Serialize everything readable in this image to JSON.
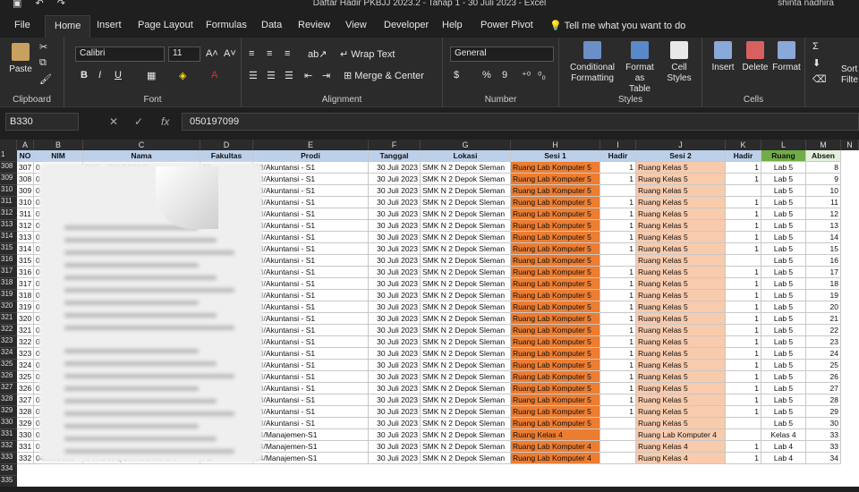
{
  "window": {
    "title": "Daftar Hadir PKBJJ 2023.2 - Tahap 1 - 30 Juli 2023 - Excel",
    "user": "shinta nadhira"
  },
  "menu": [
    "File",
    "Home",
    "Insert",
    "Page Layout",
    "Formulas",
    "Data",
    "Review",
    "View",
    "Developer",
    "Help",
    "Power Pivot"
  ],
  "tellme": "Tell me what you want to do",
  "ribbon": {
    "clipboard": {
      "paste": "Paste",
      "label": "Clipboard"
    },
    "font": {
      "name": "Calibri",
      "size": "11",
      "label": "Font",
      "bold": "B",
      "italic": "I",
      "underline": "U"
    },
    "alignment": {
      "wrap": "Wrap Text",
      "merge": "Merge & Center",
      "label": "Alignment"
    },
    "number": {
      "format": "General",
      "label": "Number",
      "percent": "%",
      "comma": "9"
    },
    "styles": {
      "cond": "Conditional",
      "cond2": "Formatting",
      "fmt": "Format as",
      "fmt2": "Table",
      "cell": "Cell",
      "cell2": "Styles",
      "label": "Styles"
    },
    "cells": {
      "insert": "Insert",
      "delete": "Delete",
      "format": "Format",
      "label": "Cells"
    },
    "editing": {
      "sort": "Sort",
      "filter": "Filte"
    }
  },
  "formula_bar": {
    "name_box": "B330",
    "value": "050197099",
    "fx": "fx"
  },
  "columns": [
    "A",
    "B",
    "C",
    "D",
    "E",
    "F",
    "G",
    "H",
    "I",
    "J",
    "K",
    "L",
    "M",
    "N"
  ],
  "headers": [
    "NO",
    "NIM",
    "Nama",
    "Fakultas",
    "Prodi",
    "Tanggal",
    "Lokasi",
    "Sesi 1",
    "Hadir",
    "Sesi 2",
    "Hadir",
    "Ruang",
    "Absen"
  ],
  "rows": [
    {
      "r": "308",
      "no": "307",
      "nim": "0",
      "nama": "DWI ...RI LESTARI",
      "fak": "FE",
      "prodi": "83/Akuntansi - S1",
      "tgl": "30 Juli 2023",
      "lok": "SMK N 2 Depok Sleman",
      "s1": "Ruang Lab Komputer 5",
      "h1": "1",
      "s2": "Ruang Kelas 5",
      "h2": "1",
      "ruang": "Lab 5",
      "absen": "8"
    },
    {
      "r": "309",
      "no": "308",
      "nim": "0",
      "nama": "",
      "fak": "FE",
      "prodi": "83/Akuntansi - S1",
      "tgl": "30 Juli 2023",
      "lok": "SMK N 2 Depok Sleman",
      "s1": "Ruang Lab Komputer 5",
      "h1": "1",
      "s2": "Ruang Kelas 5",
      "h2": "1",
      "ruang": "Lab 5",
      "absen": "9"
    },
    {
      "r": "310",
      "no": "309",
      "nim": "0",
      "nama": "",
      "fak": "FE",
      "prodi": "83/Akuntansi - S1",
      "tgl": "30 Juli 2023",
      "lok": "SMK N 2 Depok Sleman",
      "s1": "Ruang Lab Komputer 5",
      "h1": "",
      "s2": "Ruang Kelas 5",
      "h2": "",
      "ruang": "Lab 5",
      "absen": "10"
    },
    {
      "r": "311",
      "no": "310",
      "nim": "0",
      "nama": "",
      "fak": "FE",
      "prodi": "83/Akuntansi - S1",
      "tgl": "30 Juli 2023",
      "lok": "SMK N 2 Depok Sleman",
      "s1": "Ruang Lab Komputer 5",
      "h1": "1",
      "s2": "Ruang Kelas 5",
      "h2": "1",
      "ruang": "Lab 5",
      "absen": "11"
    },
    {
      "r": "312",
      "no": "311",
      "nim": "0",
      "nama": "",
      "fak": "",
      "prodi": "83/Akuntansi - S1",
      "tgl": "30 Juli 2023",
      "lok": "SMK N 2 Depok Sleman",
      "s1": "Ruang Lab Komputer 5",
      "h1": "1",
      "s2": "Ruang Kelas 5",
      "h2": "1",
      "ruang": "Lab 5",
      "absen": "12"
    },
    {
      "r": "313",
      "no": "312",
      "nim": "0",
      "nama": "",
      "fak": "",
      "prodi": "83/Akuntansi - S1",
      "tgl": "30 Juli 2023",
      "lok": "SMK N 2 Depok Sleman",
      "s1": "Ruang Lab Komputer 5",
      "h1": "1",
      "s2": "Ruang Kelas 5",
      "h2": "1",
      "ruang": "Lab 5",
      "absen": "13"
    },
    {
      "r": "314",
      "no": "313",
      "nim": "0",
      "nama": "",
      "fak": "",
      "prodi": "83/Akuntansi - S1",
      "tgl": "30 Juli 2023",
      "lok": "SMK N 2 Depok Sleman",
      "s1": "Ruang Lab Komputer 5",
      "h1": "1",
      "s2": "Ruang Kelas 5",
      "h2": "1",
      "ruang": "Lab 5",
      "absen": "14"
    },
    {
      "r": "315",
      "no": "314",
      "nim": "0",
      "nama": "",
      "fak": "",
      "prodi": "83/Akuntansi - S1",
      "tgl": "30 Juli 2023",
      "lok": "SMK N 2 Depok Sleman",
      "s1": "Ruang Lab Komputer 5",
      "h1": "1",
      "s2": "Ruang Kelas 5",
      "h2": "1",
      "ruang": "Lab 5",
      "absen": "15"
    },
    {
      "r": "316",
      "no": "315",
      "nim": "0",
      "nama": "",
      "fak": "",
      "prodi": "83/Akuntansi - S1",
      "tgl": "30 Juli 2023",
      "lok": "SMK N 2 Depok Sleman",
      "s1": "Ruang Lab Komputer 5",
      "h1": "",
      "s2": "Ruang Kelas 5",
      "h2": "",
      "ruang": "Lab 5",
      "absen": "16"
    },
    {
      "r": "317",
      "no": "316",
      "nim": "0",
      "nama": "",
      "fak": "",
      "prodi": "83/Akuntansi - S1",
      "tgl": "30 Juli 2023",
      "lok": "SMK N 2 Depok Sleman",
      "s1": "Ruang Lab Komputer 5",
      "h1": "1",
      "s2": "Ruang Kelas 5",
      "h2": "1",
      "ruang": "Lab 5",
      "absen": "17"
    },
    {
      "r": "318",
      "no": "317",
      "nim": "0",
      "nama": "",
      "fak": "",
      "prodi": "83/Akuntansi - S1",
      "tgl": "30 Juli 2023",
      "lok": "SMK N 2 Depok Sleman",
      "s1": "Ruang Lab Komputer 5",
      "h1": "1",
      "s2": "Ruang Kelas 5",
      "h2": "1",
      "ruang": "Lab 5",
      "absen": "18"
    },
    {
      "r": "319",
      "no": "318",
      "nim": "0",
      "nama": "",
      "fak": "",
      "prodi": "83/Akuntansi - S1",
      "tgl": "30 Juli 2023",
      "lok": "SMK N 2 Depok Sleman",
      "s1": "Ruang Lab Komputer 5",
      "h1": "1",
      "s2": "Ruang Kelas 5",
      "h2": "1",
      "ruang": "Lab 5",
      "absen": "19"
    },
    {
      "r": "320",
      "no": "319",
      "nim": "0",
      "nama": "",
      "fak": "",
      "prodi": "83/Akuntansi - S1",
      "tgl": "30 Juli 2023",
      "lok": "SMK N 2 Depok Sleman",
      "s1": "Ruang Lab Komputer 5",
      "h1": "1",
      "s2": "Ruang Kelas 5",
      "h2": "1",
      "ruang": "Lab 5",
      "absen": "20"
    },
    {
      "r": "321",
      "no": "320",
      "nim": "0",
      "nama": "",
      "fak": "",
      "prodi": "83/Akuntansi - S1",
      "tgl": "30 Juli 2023",
      "lok": "SMK N 2 Depok Sleman",
      "s1": "Ruang Lab Komputer 5",
      "h1": "1",
      "s2": "Ruang Kelas 5",
      "h2": "1",
      "ruang": "Lab 5",
      "absen": "21"
    },
    {
      "r": "322",
      "no": "321",
      "nim": "0",
      "nama": "",
      "fak": "",
      "prodi": "83/Akuntansi - S1",
      "tgl": "30 Juli 2023",
      "lok": "SMK N 2 Depok Sleman",
      "s1": "Ruang Lab Komputer 5",
      "h1": "1",
      "s2": "Ruang Kelas 5",
      "h2": "1",
      "ruang": "Lab 5",
      "absen": "22"
    },
    {
      "r": "323",
      "no": "322",
      "nim": "0",
      "nama": "",
      "fak": "",
      "prodi": "83/Akuntansi - S1",
      "tgl": "30 Juli 2023",
      "lok": "SMK N 2 Depok Sleman",
      "s1": "Ruang Lab Komputer 5",
      "h1": "1",
      "s2": "Ruang Kelas 5",
      "h2": "1",
      "ruang": "Lab 5",
      "absen": "23"
    },
    {
      "r": "324",
      "no": "323",
      "nim": "0",
      "nama": "",
      "fak": "",
      "prodi": "83/Akuntansi - S1",
      "tgl": "30 Juli 2023",
      "lok": "SMK N 2 Depok Sleman",
      "s1": "Ruang Lab Komputer 5",
      "h1": "1",
      "s2": "Ruang Kelas 5",
      "h2": "1",
      "ruang": "Lab 5",
      "absen": "24"
    },
    {
      "r": "325",
      "no": "324",
      "nim": "0",
      "nama": "",
      "fak": "",
      "prodi": "83/Akuntansi - S1",
      "tgl": "30 Juli 2023",
      "lok": "SMK N 2 Depok Sleman",
      "s1": "Ruang Lab Komputer 5",
      "h1": "1",
      "s2": "Ruang Kelas 5",
      "h2": "1",
      "ruang": "Lab 5",
      "absen": "25"
    },
    {
      "r": "326",
      "no": "325",
      "nim": "0",
      "nama": "",
      "fak": "",
      "prodi": "83/Akuntansi - S1",
      "tgl": "30 Juli 2023",
      "lok": "SMK N 2 Depok Sleman",
      "s1": "Ruang Lab Komputer 5",
      "h1": "1",
      "s2": "Ruang Kelas 5",
      "h2": "1",
      "ruang": "Lab 5",
      "absen": "26"
    },
    {
      "r": "327",
      "no": "326",
      "nim": "0",
      "nama": "",
      "fak": "",
      "prodi": "83/Akuntansi - S1",
      "tgl": "30 Juli 2023",
      "lok": "SMK N 2 Depok Sleman",
      "s1": "Ruang Lab Komputer 5",
      "h1": "1",
      "s2": "Ruang Kelas 5",
      "h2": "1",
      "ruang": "Lab 5",
      "absen": "27"
    },
    {
      "r": "328",
      "no": "327",
      "nim": "0",
      "nama": "",
      "fak": "",
      "prodi": "83/Akuntansi - S1",
      "tgl": "30 Juli 2023",
      "lok": "SMK N 2 Depok Sleman",
      "s1": "Ruang Lab Komputer 5",
      "h1": "1",
      "s2": "Ruang Kelas 5",
      "h2": "1",
      "ruang": "Lab 5",
      "absen": "28"
    },
    {
      "r": "329",
      "no": "328",
      "nim": "0",
      "nama": "",
      "fak": "",
      "prodi": "83/Akuntansi - S1",
      "tgl": "30 Juli 2023",
      "lok": "SMK N 2 Depok Sleman",
      "s1": "Ruang Lab Komputer 5",
      "h1": "1",
      "s2": "Ruang Kelas 5",
      "h2": "1",
      "ruang": "Lab 5",
      "absen": "29"
    },
    {
      "r": "330",
      "no": "329",
      "nim": "0",
      "nama": "",
      "fak": "",
      "prodi": "83/Akuntansi - S1",
      "tgl": "30 Juli 2023",
      "lok": "SMK N 2 Depok Sleman",
      "s1": "Ruang Lab Komputer 5",
      "h1": "",
      "s2": "Ruang Kelas 5",
      "h2": "",
      "ruang": "Lab 5",
      "absen": "30"
    },
    {
      "r": "331",
      "no": "330",
      "nim": "0",
      "nama": "",
      "fak": "",
      "prodi": "54/Manajemen-S1",
      "tgl": "30 Juli 2023",
      "lok": "SMK N 2 Depok Sleman",
      "s1": "Ruang Kelas 4",
      "h1": "",
      "s2": "Ruang Lab Komputer 4",
      "h2": "",
      "ruang": "Kelas 4",
      "absen": "33"
    },
    {
      "r": "332",
      "no": "331",
      "nim": "0",
      "nama": "",
      "fak": "",
      "prodi": "54/Manajemen-S1",
      "tgl": "30 Juli 2023",
      "lok": "SMK N 2 Depok Sleman",
      "s1": "Ruang Lab Komputer 4",
      "h1": "",
      "s2": "Ruang Kelas 4",
      "h2": "1",
      "ruang": "Lab 4",
      "absen": "33"
    },
    {
      "r": "333",
      "no": "332",
      "nim": "048800908",
      "nama": "IFTINAN QURROTA AYUN",
      "fak": "FE",
      "prodi": "54/Manajemen-S1",
      "tgl": "30 Juli 2023",
      "lok": "SMK N 2 Depok Sleman",
      "s1": "Ruang Lab Komputer 4",
      "h1": "",
      "s2": "Ruang Kelas 4",
      "h2": "1",
      "ruang": "Lab 4",
      "absen": "34"
    }
  ],
  "tail_rows": [
    "334",
    "335"
  ]
}
